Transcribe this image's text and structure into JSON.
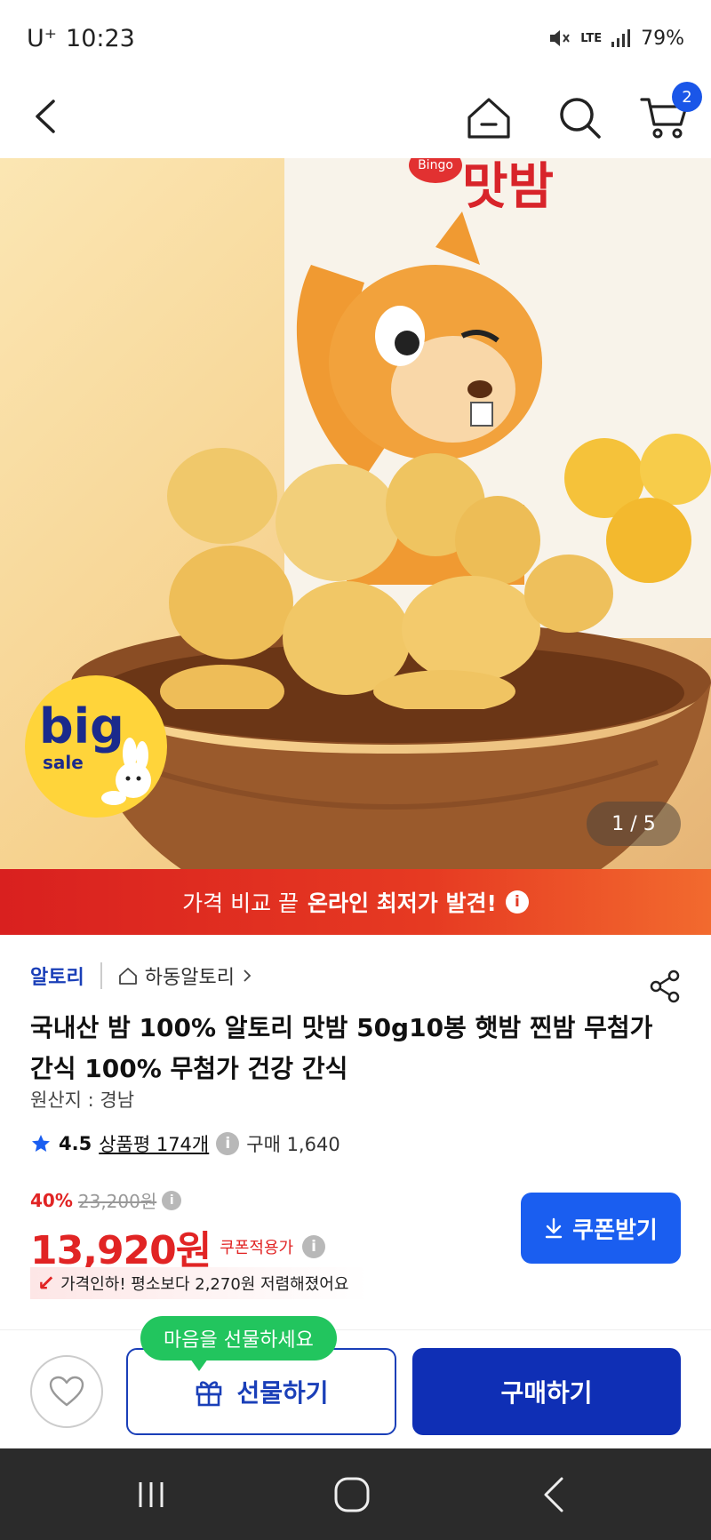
{
  "status_bar": {
    "carrier": "U⁺",
    "time": "10:23",
    "network": "LTE",
    "battery": "79%"
  },
  "header": {
    "cart_count": "2"
  },
  "hero": {
    "package_title": "맛밤",
    "package_brand": "Bingo",
    "badge_big": "big",
    "badge_sale": "sale",
    "page_indicator": "1 / 5"
  },
  "promo": {
    "text_normal": "가격 비교 끝",
    "text_bold": "온라인 최저가 발견!",
    "info_icon": "i"
  },
  "product": {
    "brand": "알토리",
    "store": "하동알토리",
    "title": "국내산 밤 100% 알토리 맛밤 50g10봉 햇밤 찐밤 무첨가 간식 100% 무첨가 건강 간식",
    "origin": "원산지 : 경남",
    "rating": "4.5",
    "reviews": "상품평 174개",
    "purchases": "구매 1,640",
    "discount_rate": "40%",
    "original_price": "23,200원",
    "price": "13,920원",
    "coupon_applied_label": "쿠폰적용가",
    "price_drop_note": "가격인하! 평소보다 2,270원 저렴해졌어요",
    "coupon_button": "쿠폰받기"
  },
  "actions": {
    "gift_tip": "마음을 선물하세요",
    "gift_button": "선물하기",
    "buy_button": "구매하기"
  },
  "colors": {
    "accent_blue": "#1a5ef0",
    "buy_blue": "#0f2fb5",
    "price_red": "#e12424",
    "promo_red": "#d9201f",
    "tip_green": "#22c55e"
  }
}
